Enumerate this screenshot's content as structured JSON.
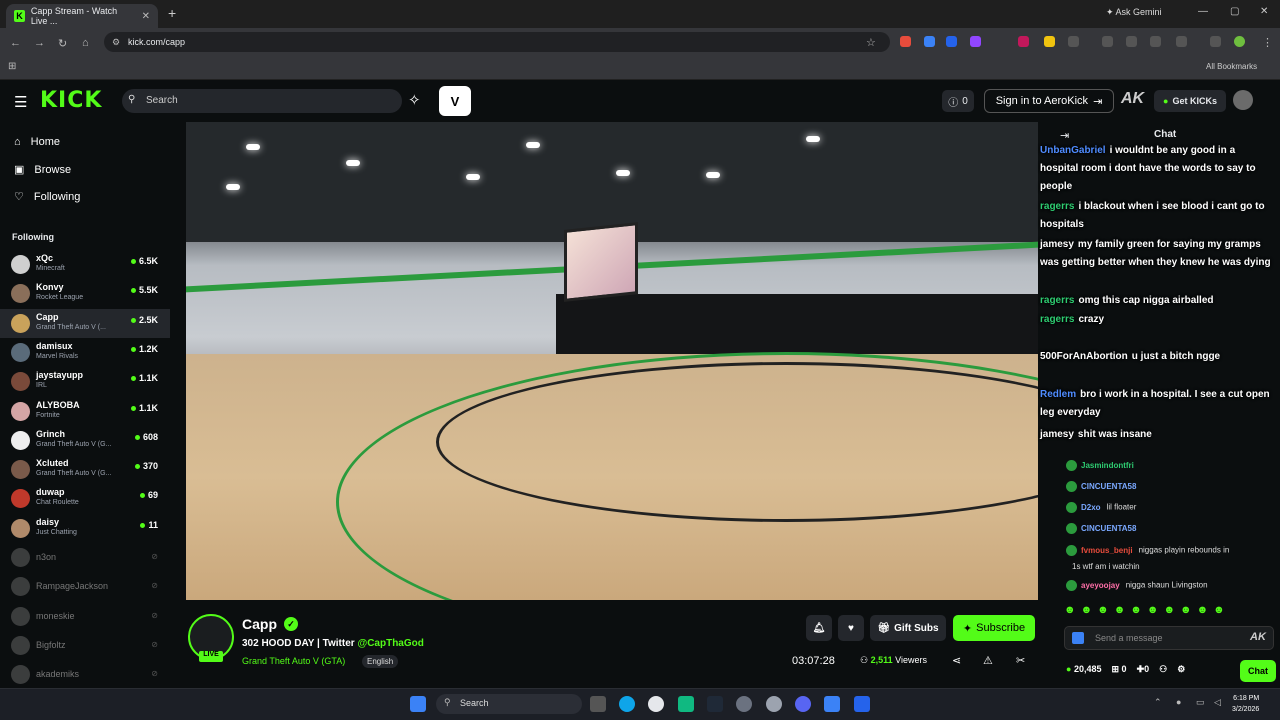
{
  "browser": {
    "tab_title": "Capp Stream - Watch Live ...",
    "tab_favicon": "K",
    "new_tab": "+",
    "gemini": "Ask Gemini",
    "url": "kick.com/capp",
    "all_bookmarks": "All Bookmarks"
  },
  "header": {
    "logo": "KICK",
    "search_placeholder": "Search",
    "v_label": "V",
    "view_count": "0",
    "signin": "Sign in to AeroKick",
    "ak": "AK",
    "get_kicks": "Get KICKs"
  },
  "sidebar": {
    "nav": [
      {
        "label": "Home",
        "icon": "home-icon"
      },
      {
        "label": "Browse",
        "icon": "browse-icon"
      },
      {
        "label": "Following",
        "icon": "heart-icon"
      }
    ],
    "following_header": "Following",
    "channels": [
      {
        "name": "xQc",
        "game": "Minecraft",
        "viewers": "6.5K",
        "color": "#cfcfcf"
      },
      {
        "name": "Konvy",
        "game": "Rocket League",
        "viewers": "5.5K",
        "color": "#8a6f5a"
      },
      {
        "name": "Capp",
        "game": "Grand Theft Auto V (...",
        "viewers": "2.5K",
        "color": "#c9a25b"
      },
      {
        "name": "damisux",
        "game": "Marvel Rivals",
        "viewers": "1.2K",
        "color": "#5a6b7a"
      },
      {
        "name": "jaystayupp",
        "game": "IRL",
        "viewers": "1.1K",
        "color": "#7a4a3a"
      },
      {
        "name": "ALYBOBA",
        "game": "Fortnite",
        "viewers": "1.1K",
        "color": "#d4a5a5"
      },
      {
        "name": "Grinch",
        "game": "Grand Theft Auto V (G...",
        "viewers": "608",
        "color": "#eeeeee"
      },
      {
        "name": "Xcluted",
        "game": "Grand Theft Auto V (G...",
        "viewers": "370",
        "color": "#7a5a4a"
      },
      {
        "name": "duwap",
        "game": "Chat Roulette",
        "viewers": "69",
        "color": "#c0392b"
      },
      {
        "name": "daisy",
        "game": "Just Chatting",
        "viewers": "11",
        "color": "#b08a6a"
      }
    ],
    "offline": [
      "n3on",
      "RampageJackson",
      "moneskie",
      "Bigfoltz",
      "akademiks"
    ]
  },
  "stream": {
    "channel": "Capp",
    "live": "LIVE",
    "title_text": "302 HOOD DAY | Twitter ",
    "twitter": "@CapThaGod",
    "category": "Grand Theft Auto V (GTA)",
    "language": "English",
    "gift_subs": "Gift Subs",
    "subscribe": "Subscribe",
    "uptime": "03:07:28",
    "viewers": "2,511",
    "viewers_label": "Viewers"
  },
  "chat": {
    "header": "Chat",
    "overlay": [
      {
        "user": "UnbanGabriel",
        "text": "i wouldnt be any good in a hospital room i dont have the words to say to people",
        "color": "#4f8cff"
      },
      {
        "user": "ragerrs",
        "text": "i blackout when i see blood i cant go to hospitals",
        "color": "#2ecc71"
      },
      {
        "user": "jamesy",
        "text": "my family green for saying my gramps was getting better when they knew he was dying",
        "color": "#ffffff"
      },
      {
        "user": "ragerrs",
        "text": "omg this cap nigga airballed",
        "color": "#2ecc71"
      },
      {
        "user": "ragerrs",
        "text": "crazy",
        "color": "#2ecc71"
      },
      {
        "user": "500ForAnAbortion",
        "text": "u just a bitch ngge",
        "color": "#ffffff"
      },
      {
        "user": "Redlem",
        "text": "bro i work in a hospital. I see a cut open leg everyday",
        "color": "#4f8cff"
      },
      {
        "user": "jamesy",
        "text": "shit was insane",
        "color": "#ffffff"
      }
    ],
    "messages": [
      {
        "user": "Jasmindontfri",
        "text": "",
        "color": "#2ecc71"
      },
      {
        "user": "CINCUENTA58",
        "text": "",
        "color": "#7aa8ff"
      },
      {
        "user": "D2xo",
        "text": "lil floater",
        "color": "#7aa8ff"
      },
      {
        "user": "CINCUENTA58",
        "text": "",
        "color": "#7aa8ff"
      },
      {
        "user": "fvmous_benji",
        "text": "niggas playin rebounds in",
        "color": "#e74c3c"
      },
      {
        "user": "",
        "text": "1s wtf am i watchin",
        "color": "#ffffff"
      },
      {
        "user": "ayeyoojay",
        "text": "nigga shaun Livingston",
        "color": "#ff6fa8"
      }
    ],
    "input_placeholder": "Send a message",
    "ak": "AK",
    "kicks": "20,485",
    "zero_a": "0",
    "zero_b": "0",
    "chat_button": "Chat"
  },
  "taskbar": {
    "search": "Search",
    "time": "6:18 PM",
    "date": "3/2/2026"
  },
  "colors": {
    "accent": "#53fc18",
    "bg": "#0b0e0f"
  }
}
